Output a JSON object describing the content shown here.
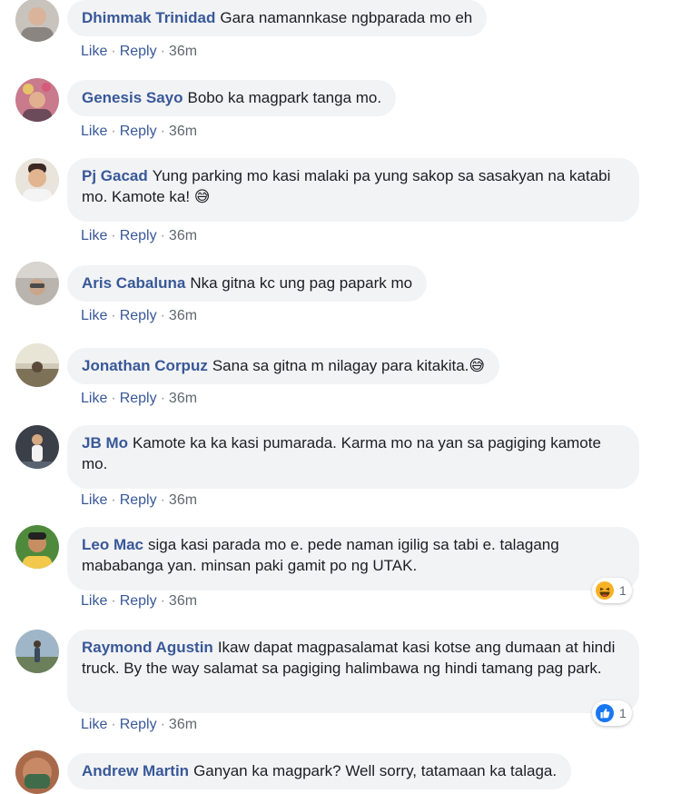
{
  "action_labels": {
    "like": "Like",
    "reply": "Reply",
    "sep": "·"
  },
  "comments": [
    {
      "author": "Dhimmak Trinidad",
      "text": "Gara namannkase ngbparada mo eh",
      "time": "36m"
    },
    {
      "author": "Genesis Sayo",
      "text": "Bobo ka magpark tanga mo.",
      "time": "36m"
    },
    {
      "author": "Pj Gacad",
      "text": "Yung parking mo kasi malaki pa yung sakop sa sasakyan na katabi mo. Kamote ka! 😅",
      "time": "36m"
    },
    {
      "author": "Aris Cabaluna",
      "text": "Nka gitna kc ung pag papark mo",
      "time": "36m"
    },
    {
      "author": "Jonathan Corpuz",
      "text": "Sana sa gitna m nilagay para kitakita.😅",
      "time": "36m"
    },
    {
      "author": "JB Mo",
      "text": "Kamote ka ka kasi pumarada. Karma mo na yan sa pagiging kamote mo.",
      "time": "36m"
    },
    {
      "author": "Leo Mac",
      "text": "siga kasi parada mo e. pede naman igilig sa tabi e. talagang mababanga yan. minsan paki gamit po ng UTAK.",
      "time": "36m",
      "reaction": {
        "icon": "haha-reaction-icon",
        "count": "1"
      }
    },
    {
      "author": "Raymond Agustin",
      "text": "Ikaw dapat magpasalamat kasi kotse ang dumaan at hindi truck. By the way salamat sa pagiging halimbawa ng hindi tamang pag park.",
      "time": "36m",
      "reaction": {
        "icon": "like-reaction-icon",
        "count": "1"
      }
    },
    {
      "author": "Andrew Martin",
      "text": "Ganyan ka magpark? Well sorry, tatamaan ka talaga.",
      "time": ""
    }
  ],
  "colors": {
    "author": "#385898",
    "bubble": "#f2f3f5",
    "meta": "#606770",
    "like_blue": "#1877f2",
    "haha_yellow": "#f7b125"
  }
}
